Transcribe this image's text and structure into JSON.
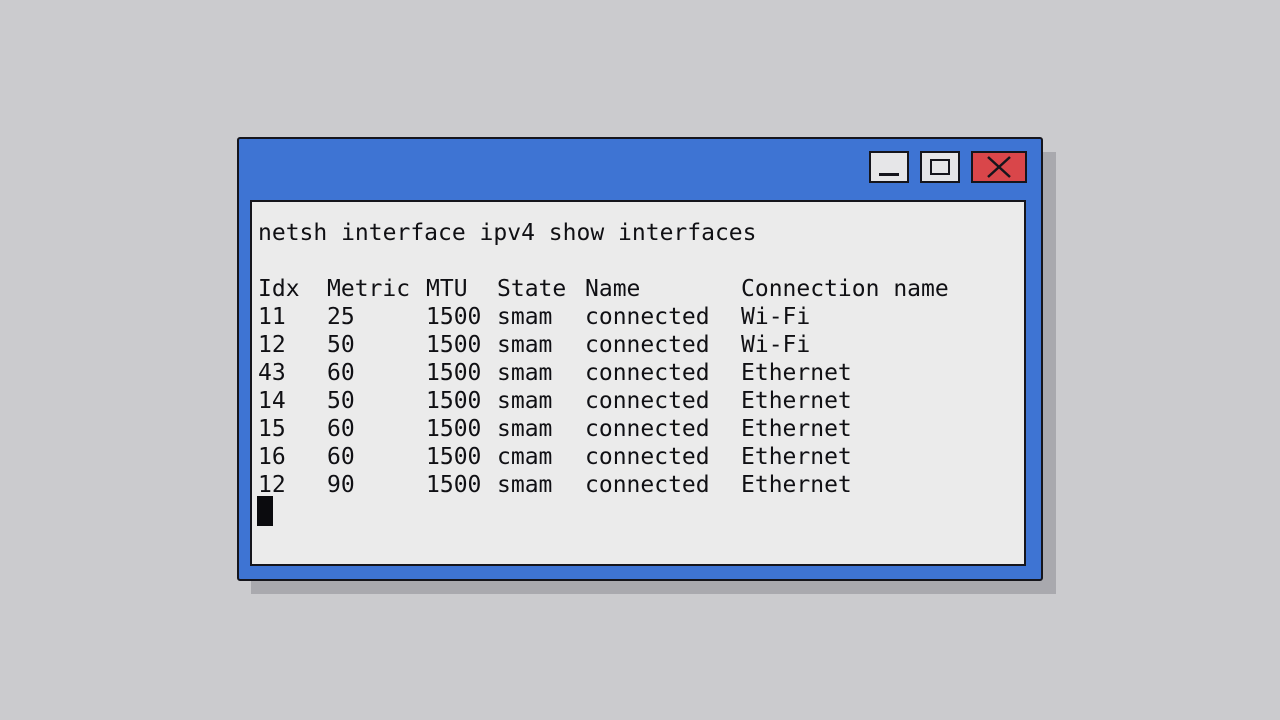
{
  "window": {
    "controls": {
      "minimize_icon": "minimize-icon",
      "maximize_icon": "maximize-icon",
      "close_icon": "close-icon",
      "close_color": "#d9464a",
      "title_bar_color": "#3e74d3"
    }
  },
  "terminal": {
    "command": "netsh interface ipv4 show interfaces",
    "headers": {
      "idx": "Idx",
      "metric": "Metric",
      "mtu": "MTU",
      "state": "State",
      "name": "Name",
      "connection_name": "Connection name"
    },
    "rows": [
      {
        "idx": "11",
        "metric": "25",
        "mtu": "1500",
        "state": "smam",
        "name": "connected",
        "connection_name": "Wi-Fi"
      },
      {
        "idx": "12",
        "metric": "50",
        "mtu": "1500",
        "state": "smam",
        "name": "connected",
        "connection_name": "Wi-Fi"
      },
      {
        "idx": "43",
        "metric": "60",
        "mtu": "1500",
        "state": "smam",
        "name": "connected",
        "connection_name": "Ethernet"
      },
      {
        "idx": "14",
        "metric": "50",
        "mtu": "1500",
        "state": "smam",
        "name": "connected",
        "connection_name": "Ethernet"
      },
      {
        "idx": "15",
        "metric": "60",
        "mtu": "1500",
        "state": "smam",
        "name": "connected",
        "connection_name": "Ethernet"
      },
      {
        "idx": "16",
        "metric": "60",
        "mtu": "1500",
        "state": "cmam",
        "name": "connected",
        "connection_name": "Ethernet"
      },
      {
        "idx": "12",
        "metric": "90",
        "mtu": "1500",
        "state": "smam",
        "name": "connected",
        "connection_name": "Ethernet"
      }
    ]
  }
}
